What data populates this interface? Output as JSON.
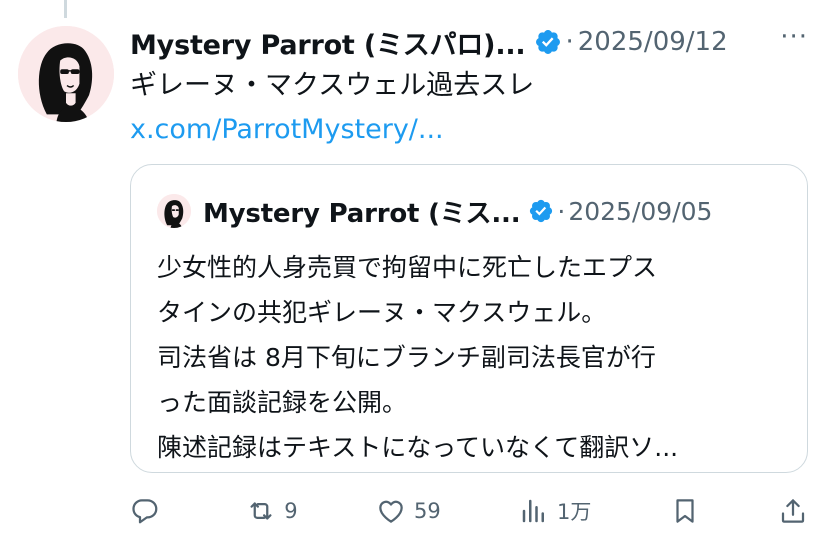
{
  "tweet": {
    "author_name": "Mystery Parrot (ミスパロ)...",
    "separator": "·",
    "date": "2025/09/12",
    "more": "···",
    "text": "ギレーヌ・マクスウェル過去スレ",
    "link": "x.com/ParrotMystery/..."
  },
  "quote": {
    "author_name": "Mystery Parrot (ミス...",
    "separator": "·",
    "date": "2025/09/05",
    "lines": [
      "少女性的人身売買で拘留中に死亡したエプス",
      "タインの共犯ギレーヌ・マクスウェル。",
      "司法省は 8月下旬にブランチ副司法長官が行",
      "った面談記録を公開。",
      "陳述記録はテキストになっていなくて翻訳ソ..."
    ]
  },
  "actions": {
    "reply": {
      "icon": "reply-icon",
      "count": ""
    },
    "repost": {
      "icon": "repost-icon",
      "count": "9"
    },
    "like": {
      "icon": "heart-icon",
      "count": "59"
    },
    "views": {
      "icon": "views-icon",
      "count": "1万"
    },
    "bookmark": {
      "icon": "bookmark-icon"
    },
    "share": {
      "icon": "share-icon"
    }
  },
  "colors": {
    "link": "#1d9bf0",
    "secondary": "#536471",
    "verified": "#1d9bf0",
    "border": "#cfd9de",
    "avatar_bg": "#fbe9ea"
  }
}
